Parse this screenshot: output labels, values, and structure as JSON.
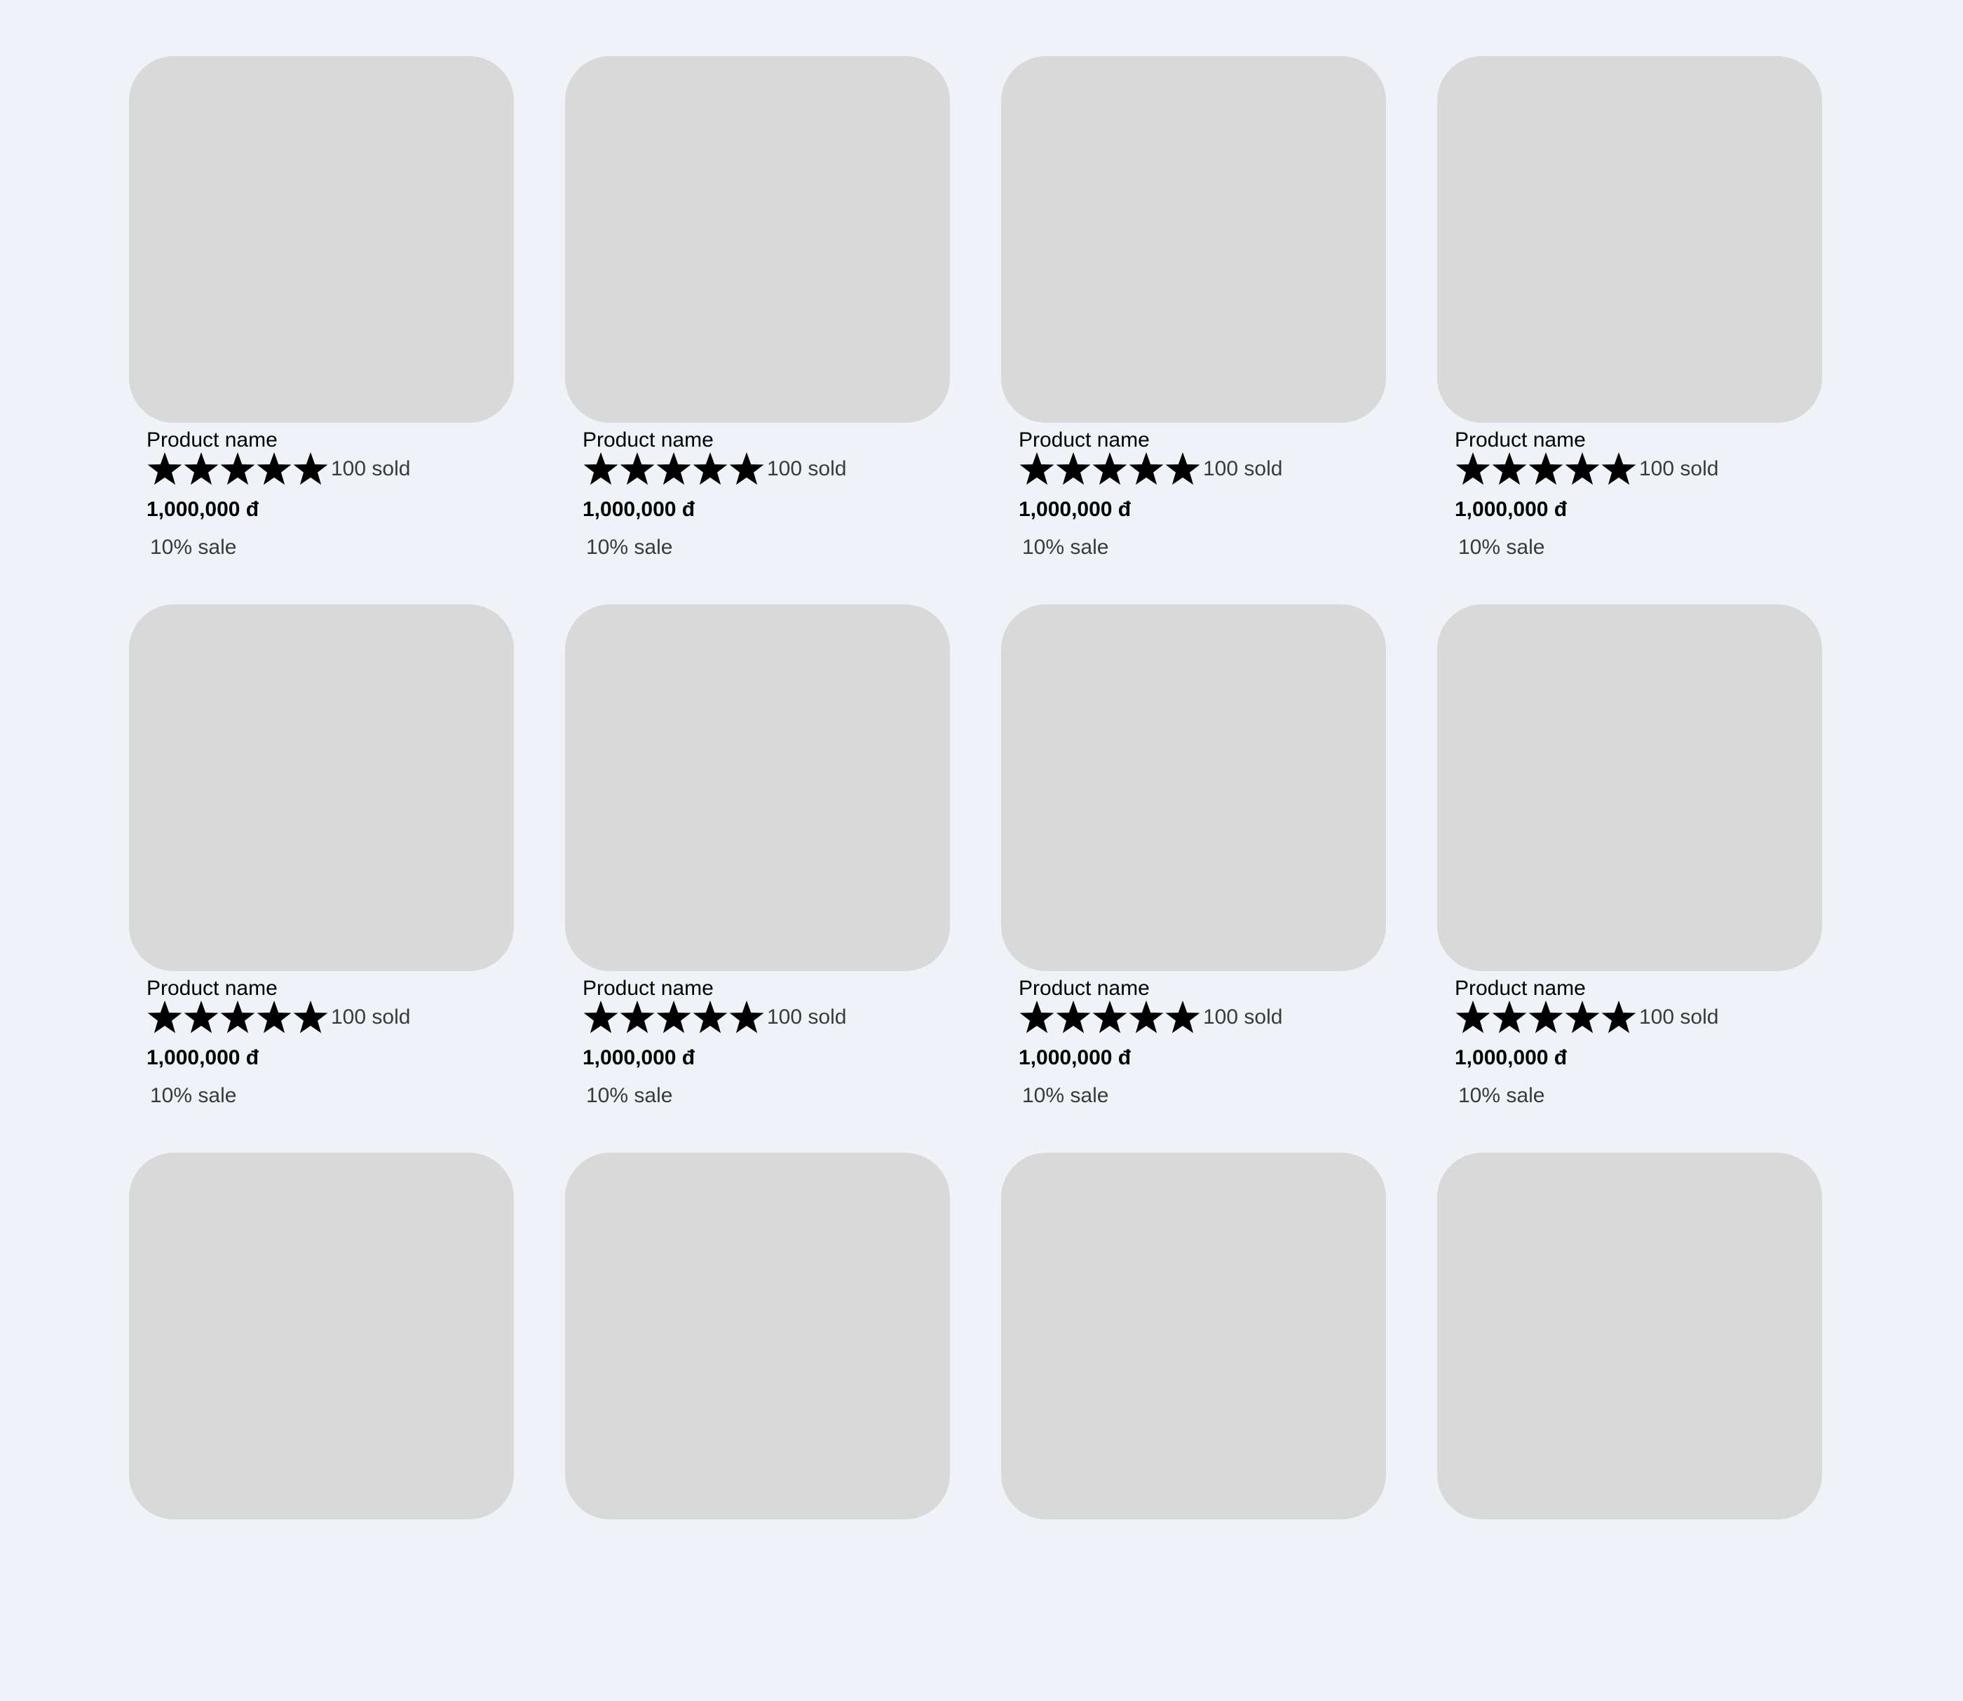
{
  "products": [
    {
      "name": "Product name",
      "rating": 5,
      "sold": "100 sold",
      "price": "1,000,000 đ",
      "sale": "10% sale"
    },
    {
      "name": "Product name",
      "rating": 5,
      "sold": "100 sold",
      "price": "1,000,000 đ",
      "sale": "10% sale"
    },
    {
      "name": "Product name",
      "rating": 5,
      "sold": "100 sold",
      "price": "1,000,000 đ",
      "sale": "10% sale"
    },
    {
      "name": "Product name",
      "rating": 5,
      "sold": "100 sold",
      "price": "1,000,000 đ",
      "sale": "10% sale"
    },
    {
      "name": "Product name",
      "rating": 5,
      "sold": "100 sold",
      "price": "1,000,000 đ",
      "sale": "10% sale"
    },
    {
      "name": "Product name",
      "rating": 5,
      "sold": "100 sold",
      "price": "1,000,000 đ",
      "sale": "10% sale"
    },
    {
      "name": "Product name",
      "rating": 5,
      "sold": "100 sold",
      "price": "1,000,000 đ",
      "sale": "10% sale"
    },
    {
      "name": "Product name",
      "rating": 5,
      "sold": "100 sold",
      "price": "1,000,000 đ",
      "sale": "10% sale"
    },
    {
      "name": "",
      "rating": 0,
      "sold": "",
      "price": "",
      "sale": ""
    },
    {
      "name": "",
      "rating": 0,
      "sold": "",
      "price": "",
      "sale": ""
    },
    {
      "name": "",
      "rating": 0,
      "sold": "",
      "price": "",
      "sale": ""
    },
    {
      "name": "",
      "rating": 0,
      "sold": "",
      "price": "",
      "sale": ""
    }
  ],
  "icons": {
    "star": "star-icon"
  },
  "colors": {
    "background": "#eff2f6",
    "placeholder": "#d9d9d9",
    "star": "#000000",
    "muted_text": "#3a3a3a"
  }
}
